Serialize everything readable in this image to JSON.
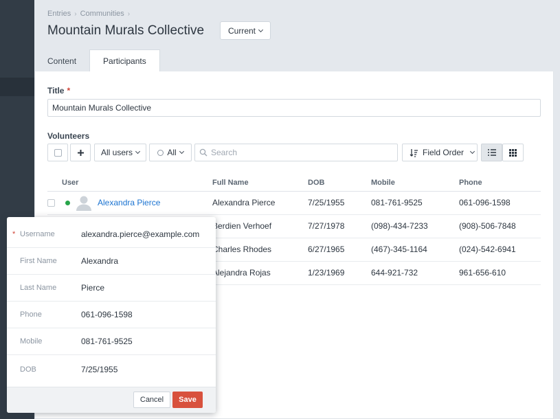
{
  "breadcrumb": [
    "Entries",
    "Communities"
  ],
  "page": {
    "title": "Mountain Murals Collective",
    "status": "Current"
  },
  "tabs": [
    {
      "label": "Content",
      "active": false
    },
    {
      "label": "Participants",
      "active": true
    }
  ],
  "form": {
    "title_label": "Title",
    "title_value": "Mountain Murals Collective",
    "volunteers_label": "Volunteers"
  },
  "toolbar": {
    "add_icon": "plus-icon",
    "users_filter": "All users",
    "status_filter": "All",
    "search_placeholder": "Search",
    "sort_label": "Field Order",
    "view_list_icon": "list-view-icon",
    "view_grid_icon": "grid-view-icon"
  },
  "table": {
    "columns": [
      "User",
      "Full Name",
      "DOB",
      "Mobile",
      "Phone"
    ],
    "rows": [
      {
        "user": "Alexandra Pierce",
        "full_name": "Alexandra Pierce",
        "dob": "7/25/1955",
        "mobile": "081-761-9525",
        "phone": "061-096-1598"
      },
      {
        "user": "",
        "full_name": "Berdien Verhoef",
        "dob": "7/27/1978",
        "mobile": "(098)-434-7233",
        "phone": "(908)-506-7848"
      },
      {
        "user": "",
        "full_name": "Charles Rhodes",
        "dob": "6/27/1965",
        "mobile": "(467)-345-1164",
        "phone": "(024)-542-6941"
      },
      {
        "user": "",
        "full_name": "Alejandra Rojas",
        "dob": "1/23/1969",
        "mobile": "644-921-732",
        "phone": "961-656-610"
      }
    ]
  },
  "popup": {
    "fields": [
      {
        "label": "Username",
        "value": "alexandra.pierce@example.com",
        "required": true
      },
      {
        "label": "First Name",
        "value": "Alexandra",
        "required": false
      },
      {
        "label": "Last Name",
        "value": "Pierce",
        "required": false
      },
      {
        "label": "Phone",
        "value": "061-096-1598",
        "required": false
      },
      {
        "label": "Mobile",
        "value": "081-761-9525",
        "required": false
      },
      {
        "label": "DOB",
        "value": "7/25/1955",
        "required": false
      }
    ],
    "cancel_label": "Cancel",
    "save_label": "Save"
  },
  "colors": {
    "accent": "#1a73d1",
    "save": "#d8513d",
    "required": "#cf4336",
    "online": "#27a54a"
  }
}
